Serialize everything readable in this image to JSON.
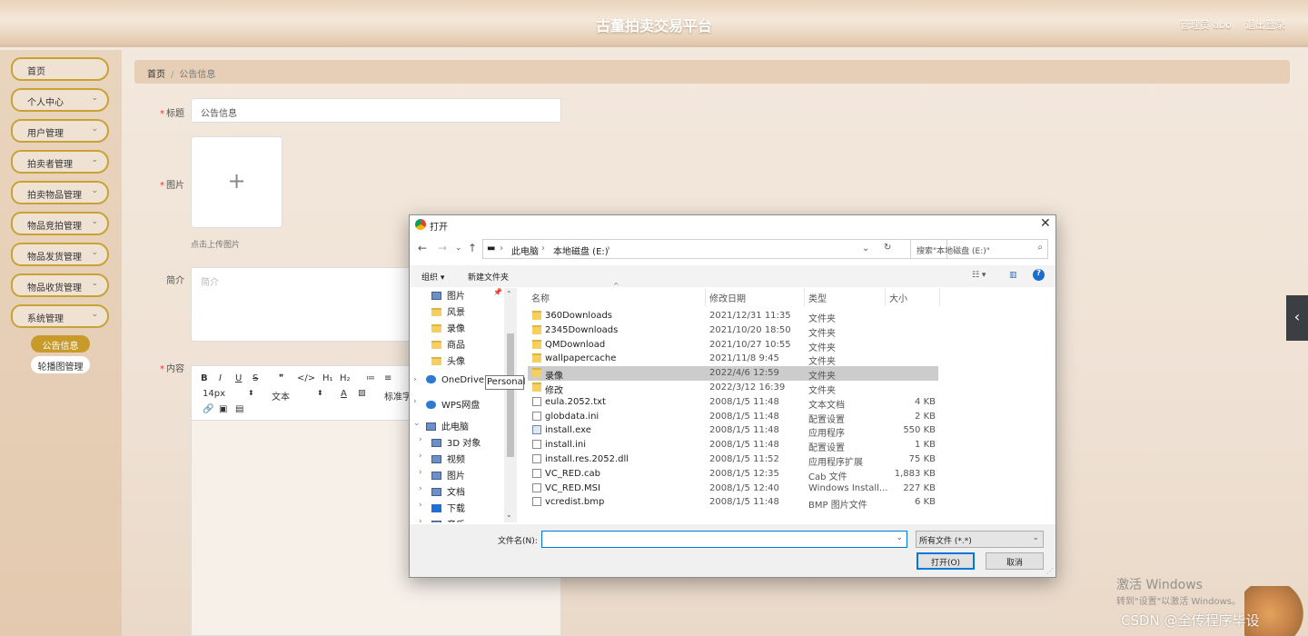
{
  "app": {
    "title": "古董拍卖交易平台",
    "user": "管理员 abo",
    "logout": "退出登录"
  },
  "sidebar": {
    "items": [
      {
        "label": "首页",
        "has_chevron": false
      },
      {
        "label": "个人中心",
        "has_chevron": true
      },
      {
        "label": "用户管理",
        "has_chevron": true
      },
      {
        "label": "拍卖者管理",
        "has_chevron": true
      },
      {
        "label": "拍卖物品管理",
        "has_chevron": true
      },
      {
        "label": "物品竞拍管理",
        "has_chevron": true
      },
      {
        "label": "物品发货管理",
        "has_chevron": true
      },
      {
        "label": "物品收货管理",
        "has_chevron": true
      },
      {
        "label": "系统管理",
        "has_chevron": true
      }
    ],
    "subitems": [
      {
        "label": "公告信息",
        "active": true
      },
      {
        "label": "轮播图管理",
        "active": false
      }
    ]
  },
  "breadcrumb": {
    "home": "首页",
    "sep": "/",
    "current": "公告信息"
  },
  "form": {
    "title_label": "标题",
    "title_value": "公告信息",
    "image_label": "图片",
    "upload_hint": "点击上传图片",
    "intro_label": "简介",
    "intro_placeholder": "简介",
    "content_label": "内容",
    "required_mark": "*"
  },
  "editor": {
    "toolbar_row1": [
      "B",
      "I",
      "U",
      "S",
      "❞",
      "</>",
      "H₁",
      "H₂",
      "≔",
      "≡"
    ],
    "font_size": "14px",
    "text_style": "文本",
    "font_family": "标准字"
  },
  "dialog": {
    "title": "打开",
    "address": {
      "root": "此电脑",
      "drive": "本地磁盘 (E:)"
    },
    "search_placeholder": "搜索\"本地磁盘 (E:)\"",
    "cmd": {
      "organize": "组织 ▾",
      "new_folder": "新建文件夹"
    },
    "nav": [
      {
        "label": "图片",
        "icon": "pictures-icon",
        "pinned": true
      },
      {
        "label": "风景",
        "icon": "folder-icon"
      },
      {
        "label": "录像",
        "icon": "folder-icon"
      },
      {
        "label": "商品",
        "icon": "folder-icon"
      },
      {
        "label": "头像",
        "icon": "folder-icon"
      },
      {
        "label": "OneDrive - Personal",
        "icon": "onedrive-icon"
      },
      {
        "label": "WPS网盘",
        "icon": "cloud-icon"
      },
      {
        "label": "此电脑",
        "icon": "computer-icon"
      },
      {
        "label": "3D 对象",
        "icon": "3d-objects-icon"
      },
      {
        "label": "视频",
        "icon": "video-icon"
      },
      {
        "label": "图片",
        "icon": "pictures-icon"
      },
      {
        "label": "文档",
        "icon": "documents-icon"
      },
      {
        "label": "下载",
        "icon": "downloads-icon"
      },
      {
        "label": "音乐",
        "icon": "music-icon"
      }
    ],
    "tooltip": "Personal",
    "columns": [
      "名称",
      "修改日期",
      "类型",
      "大小"
    ],
    "files": [
      {
        "name": "360Downloads",
        "date": "2021/12/31 11:35",
        "type": "文件夹",
        "size": "",
        "icon": "folder"
      },
      {
        "name": "2345Downloads",
        "date": "2021/10/20 18:50",
        "type": "文件夹",
        "size": "",
        "icon": "folder"
      },
      {
        "name": "QMDownload",
        "date": "2021/10/27 10:55",
        "type": "文件夹",
        "size": "",
        "icon": "folder"
      },
      {
        "name": "wallpapercache",
        "date": "2021/11/8 9:45",
        "type": "文件夹",
        "size": "",
        "icon": "folder"
      },
      {
        "name": "录像",
        "date": "2022/4/6 12:59",
        "type": "文件夹",
        "size": "",
        "icon": "folder",
        "selected": true
      },
      {
        "name": "修改",
        "date": "2022/3/12 16:39",
        "type": "文件夹",
        "size": "",
        "icon": "folder"
      },
      {
        "name": "eula.2052.txt",
        "date": "2008/1/5 11:48",
        "type": "文本文档",
        "size": "4 KB",
        "icon": "doc"
      },
      {
        "name": "globdata.ini",
        "date": "2008/1/5 11:48",
        "type": "配置设置",
        "size": "2 KB",
        "icon": "doc"
      },
      {
        "name": "install.exe",
        "date": "2008/1/5 11:48",
        "type": "应用程序",
        "size": "550 KB",
        "icon": "exe"
      },
      {
        "name": "install.ini",
        "date": "2008/1/5 11:48",
        "type": "配置设置",
        "size": "1 KB",
        "icon": "doc"
      },
      {
        "name": "install.res.2052.dll",
        "date": "2008/1/5 11:52",
        "type": "应用程序扩展",
        "size": "75 KB",
        "icon": "doc"
      },
      {
        "name": "VC_RED.cab",
        "date": "2008/1/5 12:35",
        "type": "Cab 文件",
        "size": "1,883 KB",
        "icon": "doc"
      },
      {
        "name": "VC_RED.MSI",
        "date": "2008/1/5 12:40",
        "type": "Windows Install...",
        "size": "227 KB",
        "icon": "doc"
      },
      {
        "name": "vcredist.bmp",
        "date": "2008/1/5 11:48",
        "type": "BMP 图片文件",
        "size": "6 KB",
        "icon": "doc"
      }
    ],
    "filename_label": "文件名(N):",
    "filename_value": "",
    "filetype": "所有文件 (*.*)",
    "open_button": "打开(O)",
    "cancel_button": "取消"
  },
  "watermark": {
    "line1": "激活 Windows",
    "line2": "转到\"设置\"以激活 Windows。",
    "csdn": "CSDN @全传程序毕设"
  }
}
